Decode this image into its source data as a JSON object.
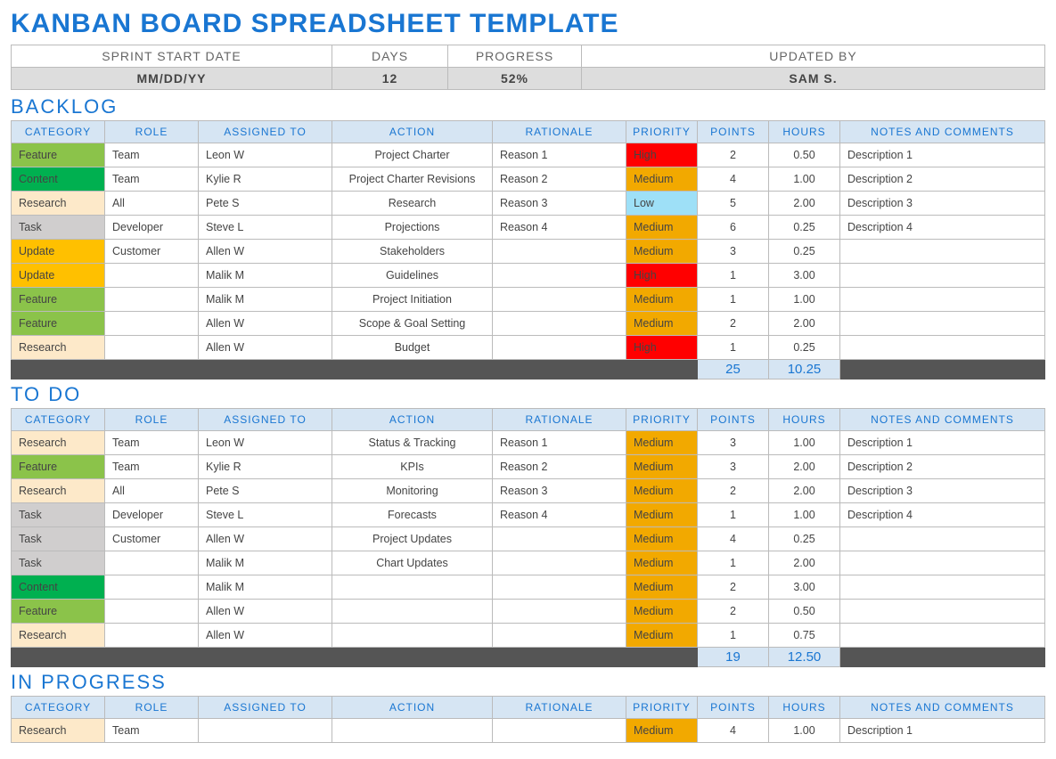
{
  "title": "KANBAN BOARD SPREADSHEET TEMPLATE",
  "header": {
    "labels": [
      "SPRINT START DATE",
      "DAYS",
      "PROGRESS",
      "UPDATED BY"
    ],
    "values": [
      "MM/DD/YY",
      "12",
      "52%",
      "SAM S."
    ]
  },
  "columns": [
    "CATEGORY",
    "ROLE",
    "ASSIGNED TO",
    "ACTION",
    "RATIONALE",
    "PRIORITY",
    "POINTS",
    "HOURS",
    "NOTES AND COMMENTS"
  ],
  "sections": [
    {
      "name": "BACKLOG",
      "rows": [
        {
          "category": "Feature",
          "role": "Team",
          "assigned": "Leon W",
          "action": "Project Charter",
          "rationale": "Reason 1",
          "priority": "High",
          "points": "2",
          "hours": "0.50",
          "notes": "Description 1"
        },
        {
          "category": "Content",
          "role": "Team",
          "assigned": "Kylie R",
          "action": "Project Charter Revisions",
          "rationale": "Reason 2",
          "priority": "Medium",
          "points": "4",
          "hours": "1.00",
          "notes": "Description 2"
        },
        {
          "category": "Research",
          "role": "All",
          "assigned": "Pete S",
          "action": "Research",
          "rationale": "Reason 3",
          "priority": "Low",
          "points": "5",
          "hours": "2.00",
          "notes": "Description 3"
        },
        {
          "category": "Task",
          "role": "Developer",
          "assigned": "Steve L",
          "action": "Projections",
          "rationale": "Reason 4",
          "priority": "Medium",
          "points": "6",
          "hours": "0.25",
          "notes": "Description 4"
        },
        {
          "category": "Update",
          "role": "Customer",
          "assigned": "Allen W",
          "action": "Stakeholders",
          "rationale": "",
          "priority": "Medium",
          "points": "3",
          "hours": "0.25",
          "notes": ""
        },
        {
          "category": "Update",
          "role": "",
          "assigned": "Malik M",
          "action": "Guidelines",
          "rationale": "",
          "priority": "High",
          "points": "1",
          "hours": "3.00",
          "notes": ""
        },
        {
          "category": "Feature",
          "role": "",
          "assigned": "Malik M",
          "action": "Project Initiation",
          "rationale": "",
          "priority": "Medium",
          "points": "1",
          "hours": "1.00",
          "notes": ""
        },
        {
          "category": "Feature",
          "role": "",
          "assigned": "Allen W",
          "action": "Scope & Goal Setting",
          "rationale": "",
          "priority": "Medium",
          "points": "2",
          "hours": "2.00",
          "notes": ""
        },
        {
          "category": "Research",
          "role": "",
          "assigned": "Allen W",
          "action": "Budget",
          "rationale": "",
          "priority": "High",
          "points": "1",
          "hours": "0.25",
          "notes": ""
        }
      ],
      "totals": {
        "points": "25",
        "hours": "10.25"
      }
    },
    {
      "name": "TO DO",
      "rows": [
        {
          "category": "Research",
          "role": "Team",
          "assigned": "Leon W",
          "action": "Status & Tracking",
          "rationale": "Reason 1",
          "priority": "Medium",
          "points": "3",
          "hours": "1.00",
          "notes": "Description 1"
        },
        {
          "category": "Feature",
          "role": "Team",
          "assigned": "Kylie R",
          "action": "KPIs",
          "rationale": "Reason 2",
          "priority": "Medium",
          "points": "3",
          "hours": "2.00",
          "notes": "Description 2"
        },
        {
          "category": "Research",
          "role": "All",
          "assigned": "Pete S",
          "action": "Monitoring",
          "rationale": "Reason 3",
          "priority": "Medium",
          "points": "2",
          "hours": "2.00",
          "notes": "Description 3"
        },
        {
          "category": "Task",
          "role": "Developer",
          "assigned": "Steve L",
          "action": "Forecasts",
          "rationale": "Reason 4",
          "priority": "Medium",
          "points": "1",
          "hours": "1.00",
          "notes": "Description 4"
        },
        {
          "category": "Task",
          "role": "Customer",
          "assigned": "Allen W",
          "action": "Project Updates",
          "rationale": "",
          "priority": "Medium",
          "points": "4",
          "hours": "0.25",
          "notes": ""
        },
        {
          "category": "Task",
          "role": "",
          "assigned": "Malik M",
          "action": "Chart Updates",
          "rationale": "",
          "priority": "Medium",
          "points": "1",
          "hours": "2.00",
          "notes": ""
        },
        {
          "category": "Content",
          "role": "",
          "assigned": "Malik M",
          "action": "",
          "rationale": "",
          "priority": "Medium",
          "points": "2",
          "hours": "3.00",
          "notes": ""
        },
        {
          "category": "Feature",
          "role": "",
          "assigned": "Allen W",
          "action": "",
          "rationale": "",
          "priority": "Medium",
          "points": "2",
          "hours": "0.50",
          "notes": ""
        },
        {
          "category": "Research",
          "role": "",
          "assigned": "Allen W",
          "action": "",
          "rationale": "",
          "priority": "Medium",
          "points": "1",
          "hours": "0.75",
          "notes": ""
        }
      ],
      "totals": {
        "points": "19",
        "hours": "12.50"
      }
    },
    {
      "name": "IN PROGRESS",
      "rows": [
        {
          "category": "Research",
          "role": "Team",
          "assigned": "",
          "action": "",
          "rationale": "",
          "priority": "Medium",
          "points": "4",
          "hours": "1.00",
          "notes": "Description 1"
        }
      ],
      "totals": null
    }
  ]
}
